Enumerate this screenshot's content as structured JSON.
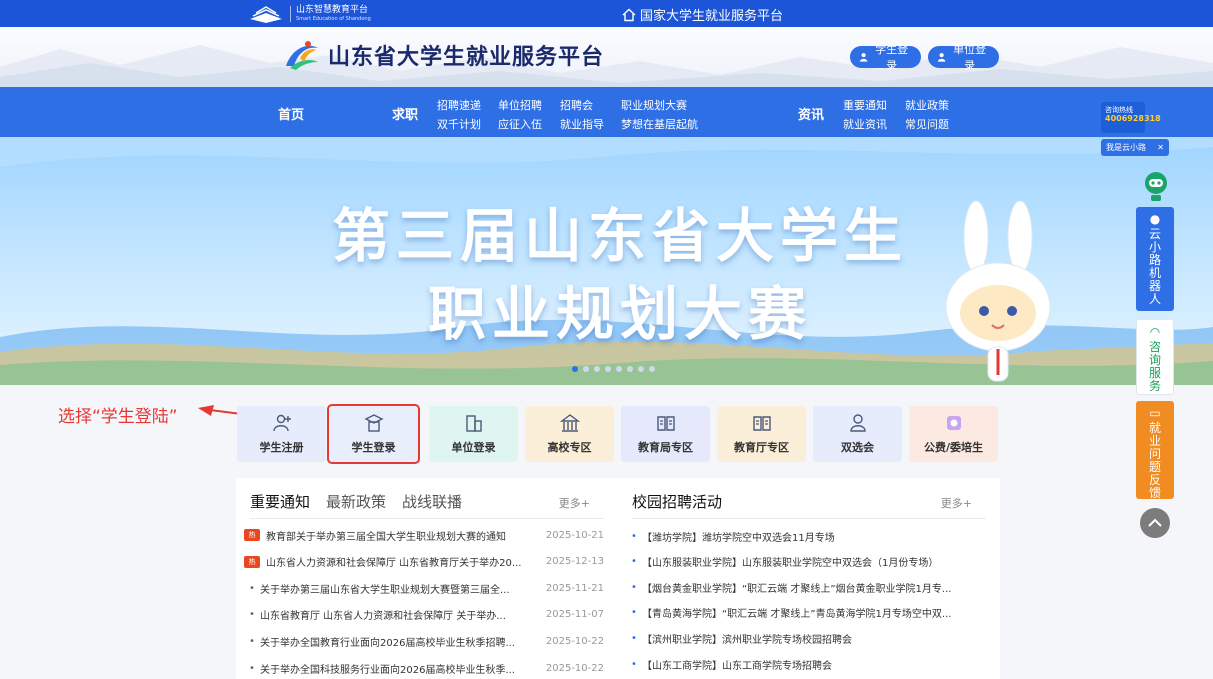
{
  "topbar": {
    "brand_cn": "山东智慧教育平台",
    "brand_en": "Smart Education of Shandong",
    "national_link": "国家大学生就业服务平台"
  },
  "header": {
    "site_title": "山东省大学生就业服务平台",
    "student_login": "学生登录",
    "unit_login": "单位登录"
  },
  "nav": {
    "home": "首页",
    "job": "求职",
    "job_links": [
      "招聘速递",
      "单位招聘",
      "招聘会",
      "职业规划大赛",
      "双千计划",
      "应征入伍",
      "就业指导",
      "梦想在基层起航"
    ],
    "info": "资讯",
    "info_links": [
      "重要通知",
      "就业政策",
      "就业资讯",
      "常见问题"
    ]
  },
  "banner": {
    "line1": "第三届山东省大学生",
    "line2": "职业规划大赛"
  },
  "float": {
    "hotline_label": "咨询热线",
    "hotline_number": "4006928318",
    "robot_tip": "我是云小路",
    "robot_btn": [
      "云",
      "小",
      "路",
      "机",
      "器",
      "人"
    ],
    "consult_btn": [
      "咨",
      "询",
      "服",
      "务"
    ],
    "feedback_btn": [
      "就",
      "业",
      "问",
      "题",
      "反",
      "馈"
    ]
  },
  "annotation": {
    "text": "选择“学生登陆”"
  },
  "tiles": [
    {
      "label": "学生注册",
      "color": "#e6ecfb",
      "icon": "user-plus-icon"
    },
    {
      "label": "学生登录",
      "color": "#e8eefb",
      "icon": "graduation-cap-icon"
    },
    {
      "label": "单位登录",
      "color": "#dff5f0",
      "icon": "building-icon"
    },
    {
      "label": "高校专区",
      "color": "#fbefd9",
      "icon": "university-icon"
    },
    {
      "label": "教育局专区",
      "color": "#e6e9fb",
      "icon": "book-icon"
    },
    {
      "label": "教育厅专区",
      "color": "#fbefd9",
      "icon": "book-icon"
    },
    {
      "label": "双选会",
      "color": "#e6ecfb",
      "icon": "person-icon"
    },
    {
      "label": "公费/委培生",
      "color": "#fbe9e2",
      "icon": "badge-icon"
    }
  ],
  "notices": {
    "tabs": [
      "重要通知",
      "最新政策",
      "战线联播"
    ],
    "more": "更多+",
    "items": [
      {
        "title": "教育部关于举办第三届全国大学生职业规划大赛的通知",
        "date": "2025-10-21",
        "hot": true
      },
      {
        "title": "山东省人力资源和社会保障厅 山东省教育厅关于举办20...",
        "date": "2025-12-13",
        "hot": true
      },
      {
        "title": "关于举办第三届山东省大学生职业规划大赛暨第三届全...",
        "date": "2025-11-21",
        "hot": false
      },
      {
        "title": "山东省教育厅 山东省人力资源和社会保障厅 关于举办...",
        "date": "2025-11-07",
        "hot": false
      },
      {
        "title": "关于举办全国教育行业面向2026届高校毕业生秋季招聘...",
        "date": "2025-10-22",
        "hot": false
      },
      {
        "title": "关于举办全国科技服务行业面向2026届高校毕业生秋季...",
        "date": "2025-10-22",
        "hot": false
      }
    ],
    "hot_badge": "热"
  },
  "campus": {
    "title": "校园招聘活动",
    "more": "更多+",
    "items": [
      "【潍坊学院】潍坊学院空中双选会11月专场",
      "【山东服装职业学院】山东服装职业学院空中双选会（1月份专场）",
      "【烟台黄金职业学院】“职汇云端 才聚线上”烟台黄金职业学院1月专...",
      "【青岛黄海学院】“职汇云端 才聚线上”青岛黄海学院1月专场空中双...",
      "【滨州职业学院】滨州职业学院专场校园招聘会",
      "【山东工商学院】山东工商学院专场招聘会"
    ]
  }
}
